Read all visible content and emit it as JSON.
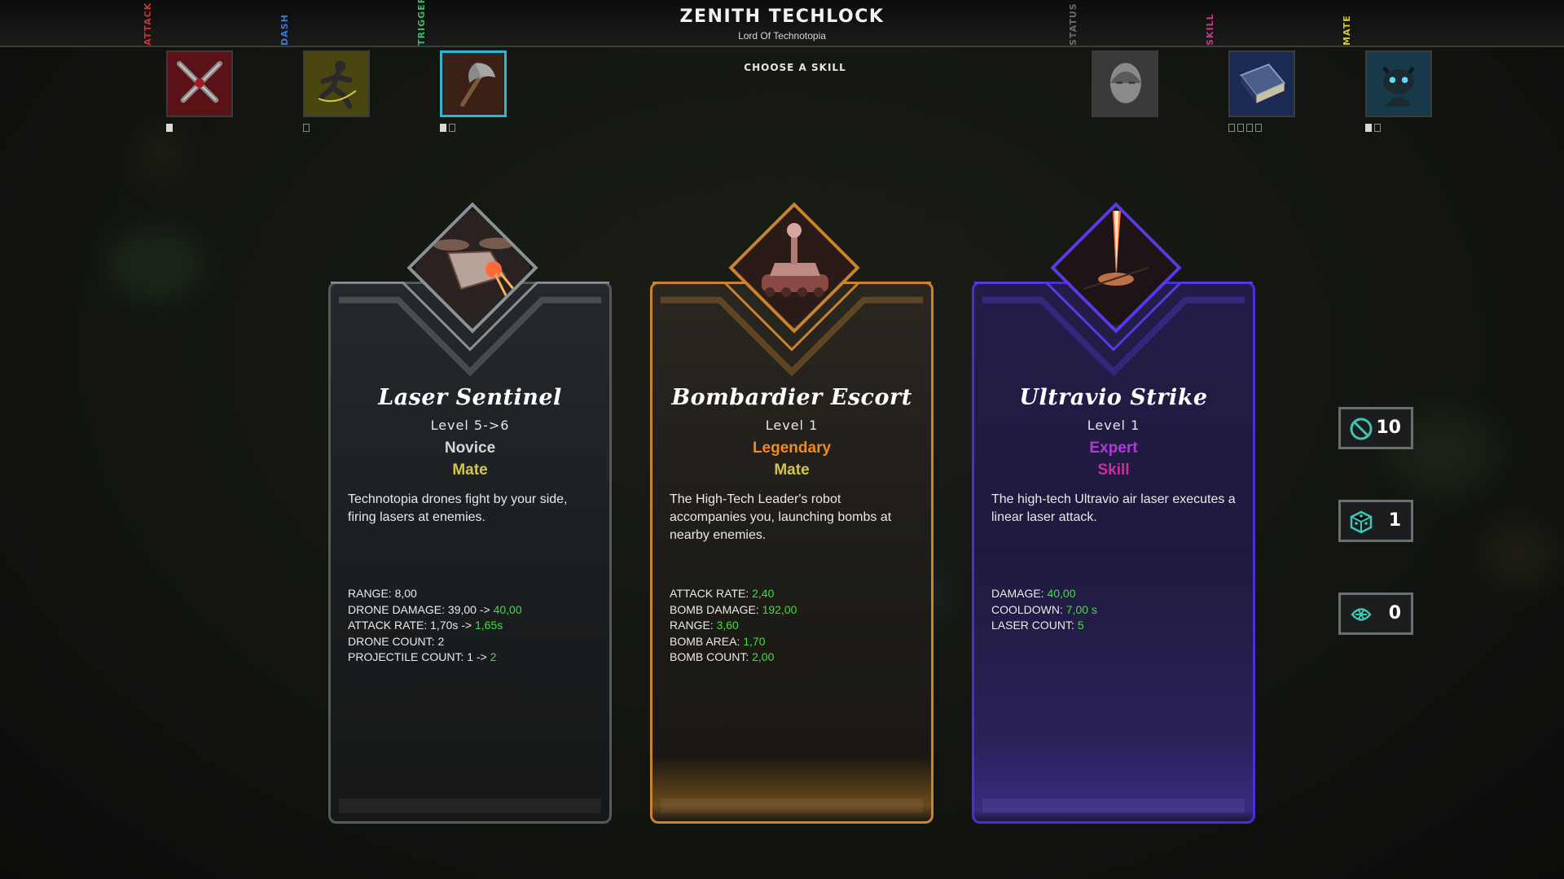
{
  "header": {
    "title": "ZENITH TECHLOCK",
    "subtitle": "Lord Of Technotopia",
    "prompt": "CHOOSE A SKILL"
  },
  "slots": [
    {
      "label": "ATTACK",
      "color": "#c8323a",
      "icon": "crossed-swords-icon",
      "pips": [
        true
      ]
    },
    {
      "label": "DASH",
      "color": "#3a78d6",
      "icon": "running-figure-icon",
      "pips": [
        false
      ]
    },
    {
      "label": "TRIGGER",
      "color": "#3cb873",
      "icon": "axe-icon",
      "pips": [
        true,
        false
      ]
    },
    {
      "label": "STATUS",
      "color": "#6a6a6a",
      "icon": "head-icon",
      "pips": []
    },
    {
      "label": "SKILL",
      "color": "#c13a8c",
      "icon": "spellbook-icon",
      "pips": [
        false,
        false,
        false,
        false
      ]
    },
    {
      "label": "MATE",
      "color": "#d6c83a",
      "icon": "robot-icon",
      "pips": [
        true,
        false
      ]
    }
  ],
  "cards": [
    {
      "name": "Laser Sentinel",
      "level": "Level  5->6",
      "rarity": "Novice",
      "rarity_color": "#d6d6d6",
      "type": "Mate",
      "type_color": "#d2c548",
      "icon": "laser-drone-icon",
      "frame": "silver",
      "description": "Technotopia drones fight by your side, firing lasers at enemies.",
      "stats": [
        {
          "label": "RANGE:",
          "value": "8,00",
          "arrow": "",
          "new": ""
        },
        {
          "label": "DRONE DAMAGE:",
          "value": "39,00",
          "arrow": "->",
          "new": "40,00"
        },
        {
          "label": "ATTACK RATE:",
          "value": "1,70s",
          "arrow": "->",
          "new": "1,65s"
        },
        {
          "label": "DRONE COUNT:",
          "value": "2",
          "arrow": "",
          "new": ""
        },
        {
          "label": "PROJECTILE COUNT:",
          "value": "1",
          "arrow": "->",
          "new": "2"
        }
      ]
    },
    {
      "name": "Bombardier Escort",
      "level": "Level  1",
      "rarity": "Legendary",
      "rarity_color": "#f08a22",
      "type": "Mate",
      "type_color": "#d2c548",
      "icon": "tank-robot-icon",
      "frame": "gold",
      "description": "The High-Tech Leader's robot accompanies you, launching bombs at nearby enemies.",
      "stats": [
        {
          "label": "ATTACK RATE:",
          "value": "",
          "arrow": "",
          "new": "2,40"
        },
        {
          "label": "BOMB DAMAGE:",
          "value": "",
          "arrow": "",
          "new": "192,00"
        },
        {
          "label": "RANGE:",
          "value": "",
          "arrow": "",
          "new": "3,60"
        },
        {
          "label": "BOMB AREA:",
          "value": "",
          "arrow": "",
          "new": "1,70"
        },
        {
          "label": "BOMB COUNT:",
          "value": "",
          "arrow": "",
          "new": "2,00"
        }
      ]
    },
    {
      "name": "Ultravio Strike",
      "level": "Level  1",
      "rarity": "Expert",
      "rarity_color": "#b03ad8",
      "type": "Skill",
      "type_color": "#c8309a",
      "icon": "laser-strike-icon",
      "frame": "purple",
      "description": "The high-tech Ultravio air laser executes a linear laser attack.",
      "stats": [
        {
          "label": "DAMAGE:",
          "value": "",
          "arrow": "",
          "new": "40,00"
        },
        {
          "label": "COOLDOWN:",
          "value": "",
          "arrow": "",
          "new": "7,00 s"
        },
        {
          "label": "LASER COUNT:",
          "value": "",
          "arrow": "",
          "new": "5"
        }
      ]
    }
  ],
  "resources": [
    {
      "icon": "banish-icon",
      "value": "10"
    },
    {
      "icon": "reroll-dice-icon",
      "value": "1"
    },
    {
      "icon": "skip-icon",
      "value": "0"
    }
  ]
}
